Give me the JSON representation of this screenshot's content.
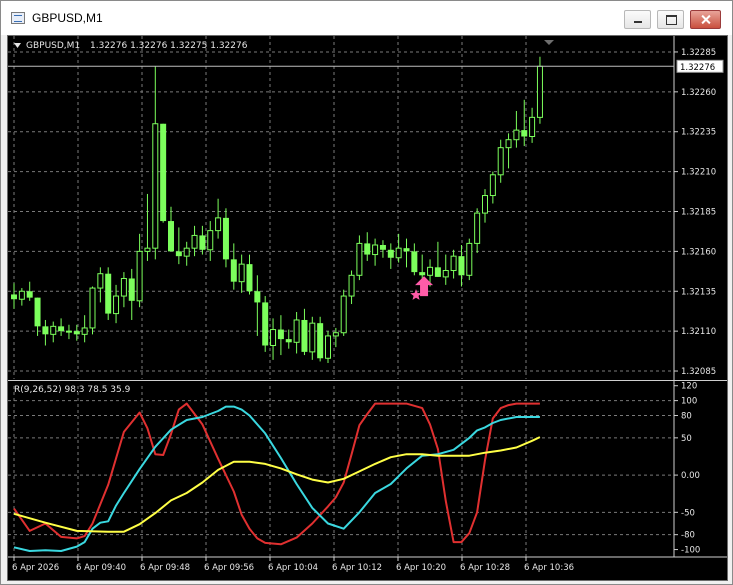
{
  "window": {
    "title": "GBPUSD,M1"
  },
  "header": {
    "symbol": "GBPUSD,M1",
    "ohlc": "1.32276 1.32276 1.32275 1.32276"
  },
  "indicator": {
    "label": "R(9,26,52) 98.3 78.5 35.9"
  },
  "colors": {
    "background": "#000000",
    "grid": "#7a7a7a",
    "candle": "#7cff5c",
    "fast_line": "#e03030",
    "mid_line": "#3ad8e0",
    "slow_line": "#ffff46",
    "arrow": "#ff5ca8",
    "text": "#e6e6e6"
  },
  "icons": {
    "arrow_up": "arrow-up-icon",
    "star": "star-icon",
    "menu": "triangle-down-icon"
  },
  "chart_data": [
    {
      "type": "candlestick",
      "symbol": "GBPUSD,M1",
      "ylim": [
        1.3208,
        1.32295
      ],
      "y_ticks": [
        "1.32285",
        "1.32260",
        "1.32235",
        "1.32210",
        "1.32185",
        "1.32160",
        "1.32135",
        "1.32110",
        "1.32085"
      ],
      "current_price": "1.32276",
      "x_ticks": [
        "6 Apr 2026",
        "6 Apr 09:40",
        "6 Apr 09:48",
        "6 Apr 09:56",
        "6 Apr 10:04",
        "6 Apr 10:12",
        "6 Apr 10:20",
        "6 Apr 10:28",
        "6 Apr 10:36"
      ],
      "candles": [
        [
          1.32133,
          1.3214,
          1.32124,
          1.3213
        ],
        [
          1.3213,
          1.32137,
          1.32126,
          1.32135
        ],
        [
          1.32135,
          1.32141,
          1.32129,
          1.32131
        ],
        [
          1.32131,
          1.32131,
          1.32107,
          1.32113
        ],
        [
          1.32113,
          1.32117,
          1.32101,
          1.32108
        ],
        [
          1.32108,
          1.32116,
          1.32103,
          1.32113
        ],
        [
          1.32113,
          1.32118,
          1.32107,
          1.3211
        ],
        [
          1.3211,
          1.32114,
          1.32105,
          1.3211
        ],
        [
          1.3211,
          1.32114,
          1.32104,
          1.32108
        ],
        [
          1.32108,
          1.3212,
          1.32103,
          1.32112
        ],
        [
          1.32112,
          1.32138,
          1.32108,
          1.32137
        ],
        [
          1.32137,
          1.3215,
          1.32128,
          1.32146
        ],
        [
          1.32146,
          1.3215,
          1.32117,
          1.32121
        ],
        [
          1.32121,
          1.32139,
          1.32115,
          1.32132
        ],
        [
          1.32132,
          1.32147,
          1.32125,
          1.32143
        ],
        [
          1.32143,
          1.32149,
          1.32117,
          1.32129
        ],
        [
          1.32129,
          1.32171,
          1.32125,
          1.3216
        ],
        [
          1.3216,
          1.32196,
          1.32154,
          1.32162
        ],
        [
          1.32162,
          1.32276,
          1.32155,
          1.3224
        ],
        [
          1.3224,
          1.3224,
          1.32178,
          1.32179
        ],
        [
          1.32179,
          1.32188,
          1.3216,
          1.3216
        ],
        [
          1.3216,
          1.32175,
          1.32152,
          1.32157
        ],
        [
          1.32157,
          1.32166,
          1.32151,
          1.32162
        ],
        [
          1.32162,
          1.32176,
          1.32157,
          1.3217
        ],
        [
          1.3217,
          1.32176,
          1.32158,
          1.32161
        ],
        [
          1.32161,
          1.32179,
          1.32154,
          1.32173
        ],
        [
          1.32173,
          1.32193,
          1.32168,
          1.32181
        ],
        [
          1.32181,
          1.32187,
          1.3215,
          1.32155
        ],
        [
          1.32155,
          1.32165,
          1.32136,
          1.32141
        ],
        [
          1.32141,
          1.32158,
          1.32134,
          1.32152
        ],
        [
          1.32152,
          1.32158,
          1.32133,
          1.32135
        ],
        [
          1.32135,
          1.32145,
          1.32107,
          1.32128
        ],
        [
          1.32128,
          1.32132,
          1.32097,
          1.32101
        ],
        [
          1.32101,
          1.32118,
          1.32092,
          1.32111
        ],
        [
          1.32111,
          1.3212,
          1.32095,
          1.32105
        ],
        [
          1.32105,
          1.32111,
          1.32099,
          1.32103
        ],
        [
          1.32103,
          1.32122,
          1.32096,
          1.32117
        ],
        [
          1.32117,
          1.32124,
          1.32095,
          1.32097
        ],
        [
          1.32097,
          1.32119,
          1.32092,
          1.32115
        ],
        [
          1.32115,
          1.32119,
          1.32091,
          1.32093
        ],
        [
          1.32093,
          1.3211,
          1.3209,
          1.32107
        ],
        [
          1.32107,
          1.32112,
          1.321,
          1.32109
        ],
        [
          1.32109,
          1.32136,
          1.32107,
          1.32132
        ],
        [
          1.32132,
          1.32148,
          1.32127,
          1.32145
        ],
        [
          1.32145,
          1.3217,
          1.32142,
          1.32165
        ],
        [
          1.32165,
          1.32172,
          1.32154,
          1.32158
        ],
        [
          1.32158,
          1.32168,
          1.32151,
          1.32164
        ],
        [
          1.32164,
          1.32167,
          1.32156,
          1.32161
        ],
        [
          1.32161,
          1.32165,
          1.32149,
          1.32156
        ],
        [
          1.32156,
          1.32171,
          1.32153,
          1.32162
        ],
        [
          1.32162,
          1.32168,
          1.3215,
          1.3216
        ],
        [
          1.3216,
          1.32165,
          1.32145,
          1.32147
        ],
        [
          1.32147,
          1.32158,
          1.32143,
          1.32145
        ],
        [
          1.32145,
          1.32155,
          1.32138,
          1.3215
        ],
        [
          1.3215,
          1.32166,
          1.32144,
          1.32144
        ],
        [
          1.32144,
          1.32158,
          1.32139,
          1.32148
        ],
        [
          1.32148,
          1.32161,
          1.32143,
          1.32157
        ],
        [
          1.32157,
          1.32164,
          1.32138,
          1.32145
        ],
        [
          1.32145,
          1.32168,
          1.32142,
          1.32165
        ],
        [
          1.32165,
          1.32187,
          1.32159,
          1.32184
        ],
        [
          1.32184,
          1.32199,
          1.32178,
          1.32195
        ],
        [
          1.32195,
          1.3221,
          1.3219,
          1.32208
        ],
        [
          1.32208,
          1.3223,
          1.32203,
          1.32225
        ],
        [
          1.32225,
          1.32234,
          1.32212,
          1.3223
        ],
        [
          1.3223,
          1.32248,
          1.32225,
          1.32236
        ],
        [
          1.32236,
          1.32255,
          1.32226,
          1.32232
        ],
        [
          1.32232,
          1.3225,
          1.32228,
          1.32244
        ],
        [
          1.32244,
          1.32282,
          1.3224,
          1.32276
        ]
      ],
      "signal": {
        "candle_index": 53,
        "price": 1.32137
      }
    },
    {
      "type": "line",
      "label": "R(9,26,52) 98.3 78.5 35.9",
      "ylim": [
        -110,
        125
      ],
      "y_ticks": [
        "120",
        "100",
        "80",
        "50",
        "0.00",
        "-50",
        "-80",
        "-100"
      ],
      "series": [
        {
          "name": "R9",
          "color": "#e03030",
          "x": [
            0,
            2,
            4,
            6,
            8,
            9,
            10,
            12,
            14,
            16,
            17,
            18,
            19,
            20,
            21,
            22,
            24,
            26,
            28,
            29,
            30,
            31,
            32,
            34,
            36,
            38,
            40,
            41,
            42,
            43,
            44,
            45,
            46,
            47,
            48,
            49,
            50,
            52,
            53,
            54,
            55,
            56,
            57,
            58,
            59,
            60,
            61,
            62,
            63,
            64,
            65,
            66,
            67
          ],
          "values": [
            -45,
            -75,
            -65,
            -83,
            -85,
            -82,
            -65,
            -13,
            58,
            84,
            63,
            28,
            27,
            55,
            88,
            96,
            68,
            22,
            -22,
            -53,
            -72,
            -85,
            -91,
            -93,
            -84,
            -65,
            -42,
            -30,
            -10,
            28,
            67,
            82,
            96,
            96,
            96,
            96,
            96,
            90,
            68,
            35,
            -35,
            -90,
            -90,
            -78,
            -50,
            20,
            76,
            90,
            94,
            96,
            96,
            96,
            96
          ]
        },
        {
          "name": "R26",
          "color": "#3ad8e0",
          "x": [
            0,
            2,
            4,
            6,
            8,
            9,
            10,
            11,
            12,
            13,
            14,
            16,
            18,
            20,
            22,
            24,
            26,
            27,
            28,
            29,
            30,
            32,
            34,
            36,
            38,
            40,
            42,
            44,
            46,
            48,
            50,
            52,
            54,
            56,
            58,
            59,
            60,
            61,
            62,
            64,
            66,
            67
          ],
          "values": [
            -97,
            -102,
            -101,
            -102,
            -96,
            -90,
            -72,
            -64,
            -62,
            -41,
            -24,
            8,
            38,
            61,
            74,
            78,
            86,
            92,
            92,
            88,
            80,
            56,
            23,
            -12,
            -44,
            -65,
            -72,
            -50,
            -24,
            -12,
            9,
            26,
            28,
            34,
            50,
            60,
            64,
            70,
            74,
            78,
            78,
            78
          ]
        },
        {
          "name": "R52",
          "color": "#ffff46",
          "x": [
            0,
            4,
            8,
            12,
            14,
            16,
            18,
            20,
            22,
            24,
            26,
            28,
            30,
            32,
            34,
            36,
            38,
            40,
            42,
            44,
            46,
            48,
            50,
            52,
            54,
            56,
            58,
            60,
            62,
            64,
            66,
            67
          ],
          "values": [
            -52,
            -64,
            -75,
            -76,
            -76,
            -66,
            -51,
            -34,
            -24,
            -10,
            7,
            18,
            18,
            15,
            9,
            1,
            -6,
            -10,
            -5,
            5,
            15,
            24,
            28,
            28,
            26,
            26,
            26,
            30,
            33,
            37,
            46,
            51
          ]
        }
      ]
    }
  ]
}
